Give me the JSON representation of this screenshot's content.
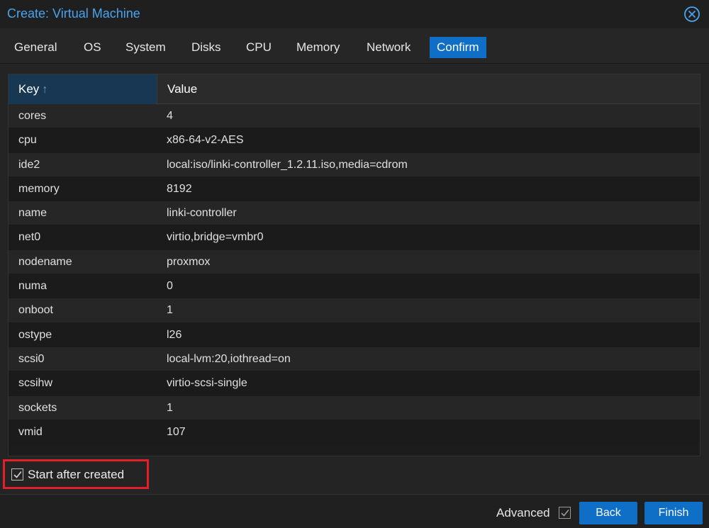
{
  "window": {
    "title": "Create: Virtual Machine",
    "close_icon": "close-circle-icon"
  },
  "tabs": [
    {
      "label": "General"
    },
    {
      "label": "OS"
    },
    {
      "label": "System"
    },
    {
      "label": "Disks"
    },
    {
      "label": "CPU"
    },
    {
      "label": "Memory"
    },
    {
      "label": "Network"
    },
    {
      "label": "Confirm",
      "active": true
    }
  ],
  "grid": {
    "headers": {
      "key": "Key",
      "value": "Value"
    },
    "sort_icon": "arrow-up-icon",
    "rows": [
      {
        "key": "cores",
        "value": "4"
      },
      {
        "key": "cpu",
        "value": "x86-64-v2-AES"
      },
      {
        "key": "ide2",
        "value": "local:iso/linki-controller_1.2.11.iso,media=cdrom"
      },
      {
        "key": "memory",
        "value": "8192"
      },
      {
        "key": "name",
        "value": "linki-controller"
      },
      {
        "key": "net0",
        "value": "virtio,bridge=vmbr0"
      },
      {
        "key": "nodename",
        "value": "proxmox"
      },
      {
        "key": "numa",
        "value": "0"
      },
      {
        "key": "onboot",
        "value": "1"
      },
      {
        "key": "ostype",
        "value": "l26"
      },
      {
        "key": "scsi0",
        "value": "local-lvm:20,iothread=on"
      },
      {
        "key": "scsihw",
        "value": "virtio-scsi-single"
      },
      {
        "key": "sockets",
        "value": "1"
      },
      {
        "key": "vmid",
        "value": "107"
      }
    ]
  },
  "options": {
    "start_after_created": {
      "label": "Start after created",
      "checked": true
    }
  },
  "footer": {
    "advanced_label": "Advanced",
    "advanced_checked": true,
    "back_label": "Back",
    "finish_label": "Finish"
  },
  "colors": {
    "accent": "#0f6fc6",
    "title": "#4aa3ef",
    "highlight_border": "#e0202a"
  }
}
